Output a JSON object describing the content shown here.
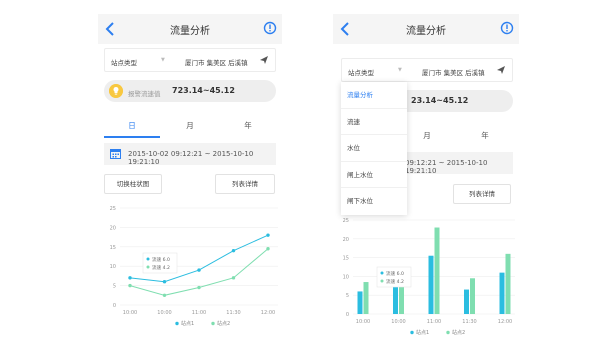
{
  "colors": {
    "accent": "#2d7ff0",
    "station1": "#2bbde0",
    "station2": "#7fdeb0",
    "warning": "#f8c840"
  },
  "screen1": {
    "nav": {
      "title": "流量分析"
    },
    "filter": {
      "type_label": "站点类型",
      "location": "厦门市 集美区 后溪镇"
    },
    "alert": {
      "label": "报警流速值",
      "value": "723.14~45.12"
    },
    "tabs": [
      "日",
      "月",
      "年"
    ],
    "date_range": "2015-10-02 09:12:21 ~ 2015-10-10 19:21:10",
    "buttons": {
      "switch": "切换柱状图",
      "detail": "列表详情"
    },
    "tooltip": [
      "流速 6.0",
      "流速 4.2"
    ]
  },
  "screen2": {
    "nav": {
      "title": "流量分析"
    },
    "filter": {
      "type_label": "站点类型",
      "location": "厦门市 集美区 后溪镇"
    },
    "alert": {
      "value": "23.14~45.12"
    },
    "tabs": [
      "月",
      "年"
    ],
    "date_range": "09:12:21 ~ 2015-10-10 19:21:10",
    "buttons": {
      "detail": "列表详情"
    },
    "dropdown": [
      "流量分析",
      "流速",
      "水位",
      "闸上水位",
      "闸下水位"
    ],
    "tooltip": [
      "流速 6.0",
      "流速 4.2"
    ]
  },
  "chart_data": [
    {
      "type": "line",
      "x": [
        "10:00",
        "10:00",
        "11:00",
        "11:30",
        "12:00"
      ],
      "ylim": [
        0,
        25
      ],
      "yticks": [
        "0",
        "5",
        "10",
        "15",
        "20",
        "25"
      ],
      "series": [
        {
          "name": "站点1",
          "values": [
            7,
            6,
            9,
            14,
            18
          ]
        },
        {
          "name": "站点2",
          "values": [
            5,
            2.5,
            4.5,
            7,
            14.5
          ]
        }
      ],
      "legend": "bottom"
    },
    {
      "type": "bar",
      "x": [
        "10:00",
        "10:00",
        "11:00",
        "11:30",
        "12:00"
      ],
      "ylim": [
        0,
        25
      ],
      "yticks": [
        "0",
        "5",
        "10",
        "15",
        "20",
        "25"
      ],
      "series": [
        {
          "name": "站点1",
          "values": [
            6,
            9,
            15.5,
            6.5,
            11
          ]
        },
        {
          "name": "站点2",
          "values": [
            8.5,
            11,
            23,
            9.5,
            16
          ]
        }
      ],
      "legend": "bottom"
    }
  ]
}
